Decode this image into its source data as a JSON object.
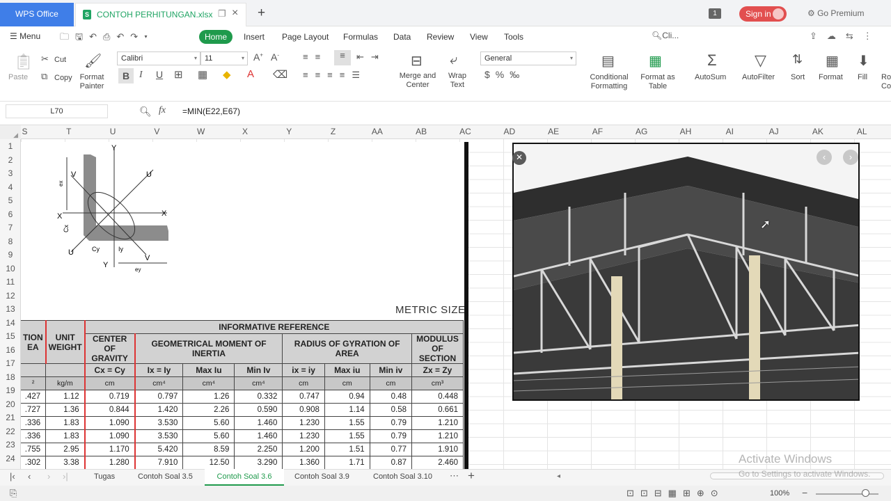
{
  "titlebar": {
    "app": "WPS Office",
    "file": "CONTOH PERHITUNGAN.xlsx",
    "file_icon": "S",
    "badge": "1",
    "signin": "Sign in",
    "premium": "Go Premium"
  },
  "menu": {
    "menu_label": "Menu",
    "tabs": [
      "Home",
      "Insert",
      "Page Layout",
      "Formulas",
      "Data",
      "Review",
      "View",
      "Tools"
    ],
    "search": "Cli..."
  },
  "toolbar": {
    "paste": "Paste",
    "cut": "Cut",
    "copy": "Copy",
    "format_painter_1": "Format",
    "format_painter_2": "Painter",
    "font": "Calibri",
    "size": "11",
    "merge_1": "Merge and",
    "merge_2": "Center",
    "wrap_1": "Wrap",
    "wrap_2": "Text",
    "number_format": "General",
    "cond_1": "Conditional",
    "cond_2": "Formatting",
    "fmt_table_1": "Format as",
    "fmt_table_2": "Table",
    "autosum": "AutoSum",
    "autofilter": "AutoFilter",
    "sort": "Sort",
    "format": "Format",
    "fill": "Fill",
    "ro": "Ro",
    "co": "Co"
  },
  "formula_bar": {
    "cell": "L70",
    "fx": "fx",
    "formula": "=MIN(E22,E67)"
  },
  "columns": [
    "S",
    "T",
    "U",
    "V",
    "W",
    "X",
    "Y",
    "Z",
    "AA",
    "AB",
    "AC",
    "AD",
    "AE",
    "AF",
    "AG",
    "AH",
    "AI",
    "AJ",
    "AK",
    "AL"
  ],
  "rows": [
    "1",
    "2",
    "3",
    "4",
    "5",
    "6",
    "7",
    "8",
    "9",
    "10",
    "11",
    "12",
    "13",
    "14",
    "15",
    "16",
    "17",
    "18",
    "19",
    "20",
    "21",
    "22",
    "23",
    "24"
  ],
  "image_text": {
    "metric": "METRIC SIZE",
    "diag_labels": [
      "Y",
      "V",
      "U",
      "X",
      "X",
      "U",
      "Y",
      "V",
      "Cy",
      "Cx",
      "ey",
      "ex",
      "Iy"
    ]
  },
  "table": {
    "informative": "INFORMATIVE REFERENCE",
    "h_area": "TION EA",
    "h_unit": "UNIT WEIGHT",
    "h_cog": "CENTER OF GRAVITY",
    "h_geo": "GEOMETRICAL MOMENT OF INERTIA",
    "h_rad": "RADIUS OF GYRATION OF AREA",
    "h_mod": "MODULUS OF SECTION",
    "sub": [
      "",
      "",
      "Cx = Cy",
      "Ix = Iy",
      "Max Iu",
      "Min Iv",
      "ix = iy",
      "Max iu",
      "Min iv",
      "Zx = Zy"
    ],
    "units": [
      "²",
      "kg/m",
      "cm",
      "cm⁴",
      "cm⁴",
      "cm⁴",
      "cm",
      "cm",
      "cm",
      "cm³"
    ],
    "rows": [
      [
        ".427",
        "1.12",
        "0.719",
        "0.797",
        "1.26",
        "0.332",
        "0.747",
        "0.94",
        "0.48",
        "0.448"
      ],
      [
        ".727",
        "1.36",
        "0.844",
        "1.420",
        "2.26",
        "0.590",
        "0.908",
        "1.14",
        "0.58",
        "0.661"
      ],
      [
        ".336",
        "1.83",
        "1.090",
        "3.530",
        "5.60",
        "1.460",
        "1.230",
        "1.55",
        "0.79",
        "1.210"
      ],
      [
        ".336",
        "1.83",
        "1.090",
        "3.530",
        "5.60",
        "1.460",
        "1.230",
        "1.55",
        "0.79",
        "1.210"
      ],
      [
        ".755",
        "2.95",
        "1.170",
        "5.420",
        "8.59",
        "2.250",
        "1.200",
        "1.51",
        "0.77",
        "1.910"
      ],
      [
        ".302",
        "3.38",
        "1.280",
        "7.910",
        "12.50",
        "3.290",
        "1.360",
        "1.71",
        "0.87",
        "2.460"
      ]
    ]
  },
  "photo": {
    "close": "✕",
    "prev": "‹",
    "next": "›"
  },
  "sheets": [
    "Tugas",
    "Contoh Soal 3.5",
    "Contoh Soal 3.6",
    "Contoh Soal 3.9",
    "Contoh Soal 3.10"
  ],
  "active_sheet": "Contoh Soal 3.6",
  "status": {
    "zoom": "100%"
  },
  "watermark": {
    "line1": "Activate Windows",
    "line2": "Go to Settings to activate Windows."
  },
  "colors": {
    "accent": "#1f9a4c",
    "wps_blue": "#3f7ee8",
    "signin": "#e24f4f"
  }
}
